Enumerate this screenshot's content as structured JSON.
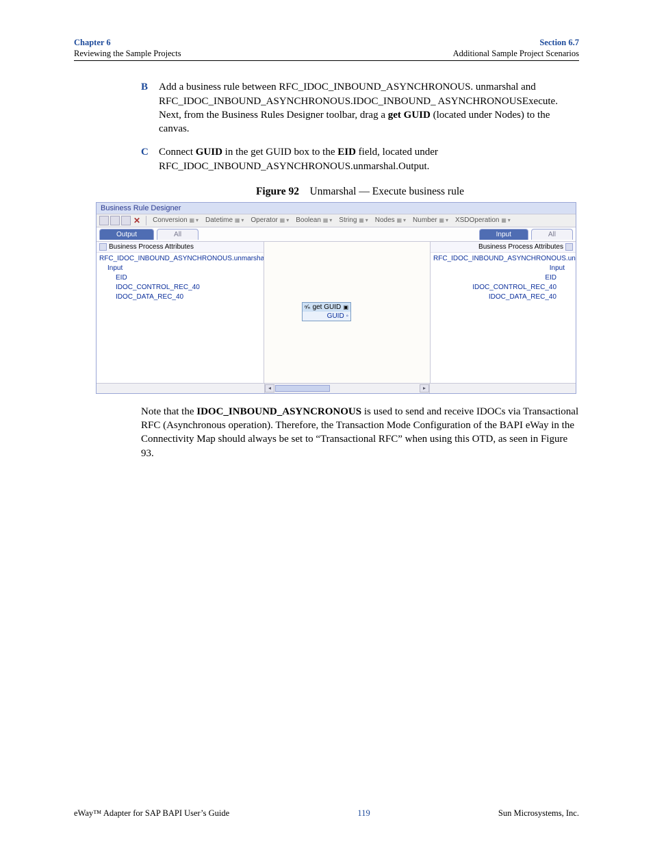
{
  "header": {
    "chapter": "Chapter 6",
    "chapter_sub": "Reviewing the Sample Projects",
    "section": "Section 6.7",
    "section_sub": "Additional Sample Project Scenarios"
  },
  "steps": {
    "b": {
      "marker": "B",
      "text_pre": "Add a business rule between RFC_IDOC_INBOUND_ASYNCHRONOUS. unmarshal and RFC_IDOC_INBOUND_ASYNCHRONOUS.IDOC_INBOUND_ ASYNCHRONOUSExecute. Next, from the Business Rules Designer toolbar, drag a ",
      "bold": "get GUID",
      "text_post": " (located under Nodes) to the canvas."
    },
    "c": {
      "marker": "C",
      "pre": "Connect ",
      "b1": "GUID",
      "mid": " in the get GUID box to the ",
      "b2": "EID",
      "post": " field, located under RFC_IDOC_INBOUND_ASYNCHRONOUS.unmarshal.Output."
    }
  },
  "figure": {
    "label": "Figure 92",
    "caption": "Unmarshal — Execute business rule"
  },
  "designer": {
    "title": "Business Rule Designer",
    "menus": [
      "Conversion",
      "Datetime",
      "Operator",
      "Boolean",
      "String",
      "Nodes",
      "Number",
      "XSDOperation"
    ],
    "tabs_left": {
      "active": "Output",
      "inactive": "All"
    },
    "tabs_right": {
      "active": "Input",
      "inactive": "All"
    },
    "left_tree": {
      "title": "Business Process Attributes",
      "items": [
        {
          "label": "RFC_IDOC_INBOUND_ASYNCHRONOUS.unmarshal.Output",
          "cls": ""
        },
        {
          "label": "Input",
          "cls": "ind1"
        },
        {
          "label": "EID",
          "cls": "ind2"
        },
        {
          "label": "IDOC_CONTROL_REC_40",
          "cls": "ind2"
        },
        {
          "label": "IDOC_DATA_REC_40",
          "cls": "ind2"
        }
      ]
    },
    "right_tree": {
      "title": "Business Process Attributes",
      "items": [
        {
          "label": "RFC_IDOC_INBOUND_ASYNCHRONOUS.unmarshal.Output",
          "cls": ""
        },
        {
          "label": "Input",
          "cls": "ind1"
        },
        {
          "label": "EID",
          "cls": "ind2"
        },
        {
          "label": "IDOC_CONTROL_REC_40",
          "cls": "ind2"
        },
        {
          "label": "IDOC_DATA_REC_40",
          "cls": "ind2"
        }
      ]
    },
    "canvas_box": {
      "title": "get GUID",
      "field": "GUID"
    }
  },
  "note": {
    "pre": "Note that the ",
    "b": "IDOC_INBOUND_ASYNCRONOUS",
    "post": " is used to send and receive IDOCs via Transactional RFC (Asynchronous operation). Therefore, the Transaction Mode Configuration of the BAPI eWay in the Connectivity Map should always be set to “Transactional RFC” when using this OTD, as seen in Figure 93."
  },
  "footer": {
    "left": "eWay™ Adapter for SAP BAPI User’s Guide",
    "page": "119",
    "right": "Sun Microsystems, Inc."
  }
}
